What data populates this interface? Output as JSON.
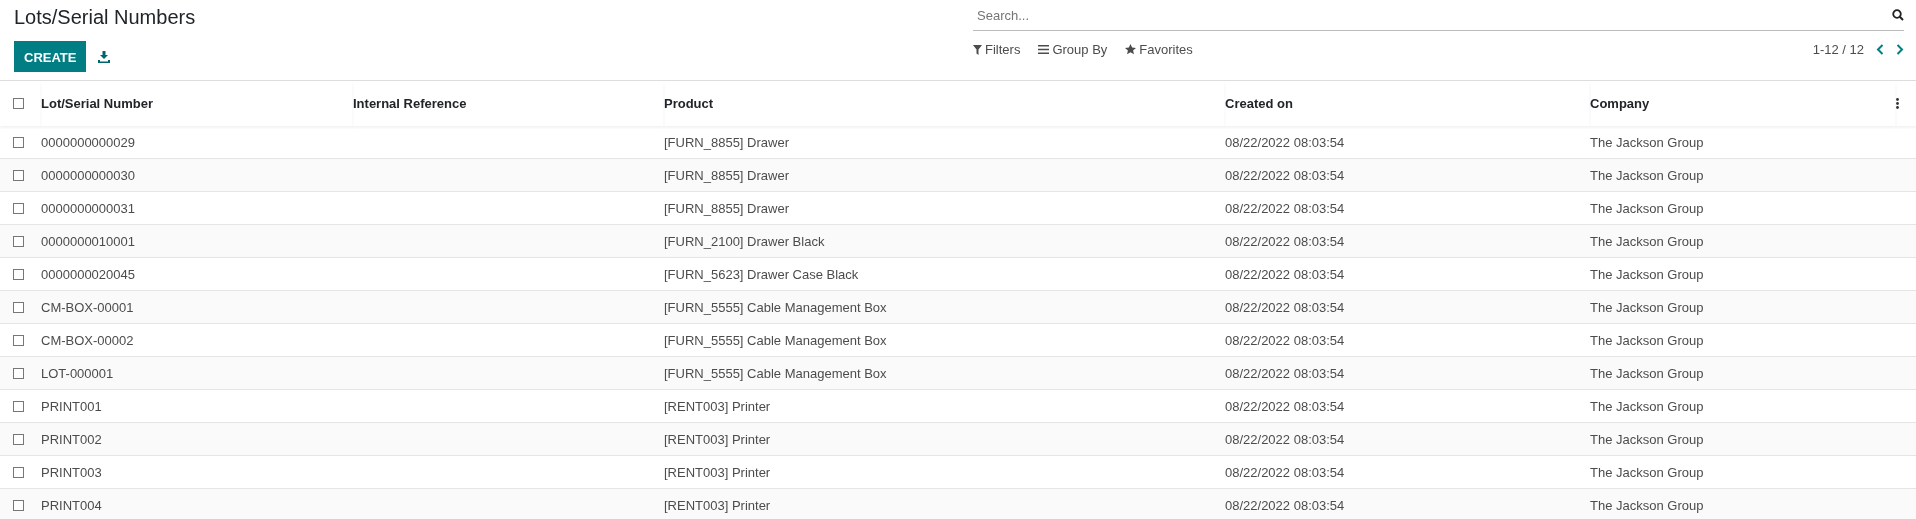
{
  "title": "Lots/Serial Numbers",
  "create_button": "CREATE",
  "search": {
    "placeholder": "Search..."
  },
  "filters": [
    "Filters",
    "Group By",
    "Favorites"
  ],
  "pager": "1-12 / 12",
  "table": {
    "columns": [
      "Lot/Serial Number",
      "Internal Reference",
      "Product",
      "Created on",
      "Company"
    ],
    "select_all_checked": false,
    "rows": [
      {
        "cells": [
          "0000000000029",
          "",
          "[FURN_8855] Drawer",
          "08/22/2022 08:03:54",
          "The Jackson Group"
        ],
        "checked": false
      },
      {
        "cells": [
          "0000000000030",
          "",
          "[FURN_8855] Drawer",
          "08/22/2022 08:03:54",
          "The Jackson Group"
        ],
        "checked": false
      },
      {
        "cells": [
          "0000000000031",
          "",
          "[FURN_8855] Drawer",
          "08/22/2022 08:03:54",
          "The Jackson Group"
        ],
        "checked": false
      },
      {
        "cells": [
          "0000000010001",
          "",
          "[FURN_2100] Drawer Black",
          "08/22/2022 08:03:54",
          "The Jackson Group"
        ],
        "checked": false
      },
      {
        "cells": [
          "0000000020045",
          "",
          "[FURN_5623] Drawer Case Black",
          "08/22/2022 08:03:54",
          "The Jackson Group"
        ],
        "checked": false
      },
      {
        "cells": [
          "CM-BOX-00001",
          "",
          "[FURN_5555] Cable Management Box",
          "08/22/2022 08:03:54",
          "The Jackson Group"
        ],
        "checked": false
      },
      {
        "cells": [
          "CM-BOX-00002",
          "",
          "[FURN_5555] Cable Management Box",
          "08/22/2022 08:03:54",
          "The Jackson Group"
        ],
        "checked": false
      },
      {
        "cells": [
          "LOT-000001",
          "",
          "[FURN_5555] Cable Management Box",
          "08/22/2022 08:03:54",
          "The Jackson Group"
        ],
        "checked": false
      },
      {
        "cells": [
          "PRINT001",
          "",
          "[RENT003] Printer",
          "08/22/2022 08:03:54",
          "The Jackson Group"
        ],
        "checked": false
      },
      {
        "cells": [
          "PRINT002",
          "",
          "[RENT003] Printer",
          "08/22/2022 08:03:54",
          "The Jackson Group"
        ],
        "checked": false
      },
      {
        "cells": [
          "PRINT003",
          "",
          "[RENT003] Printer",
          "08/22/2022 08:03:54",
          "The Jackson Group"
        ],
        "checked": false
      },
      {
        "cells": [
          "PRINT004",
          "",
          "[RENT003] Printer",
          "08/22/2022 08:03:54",
          "The Jackson Group"
        ],
        "checked": false
      }
    ]
  }
}
